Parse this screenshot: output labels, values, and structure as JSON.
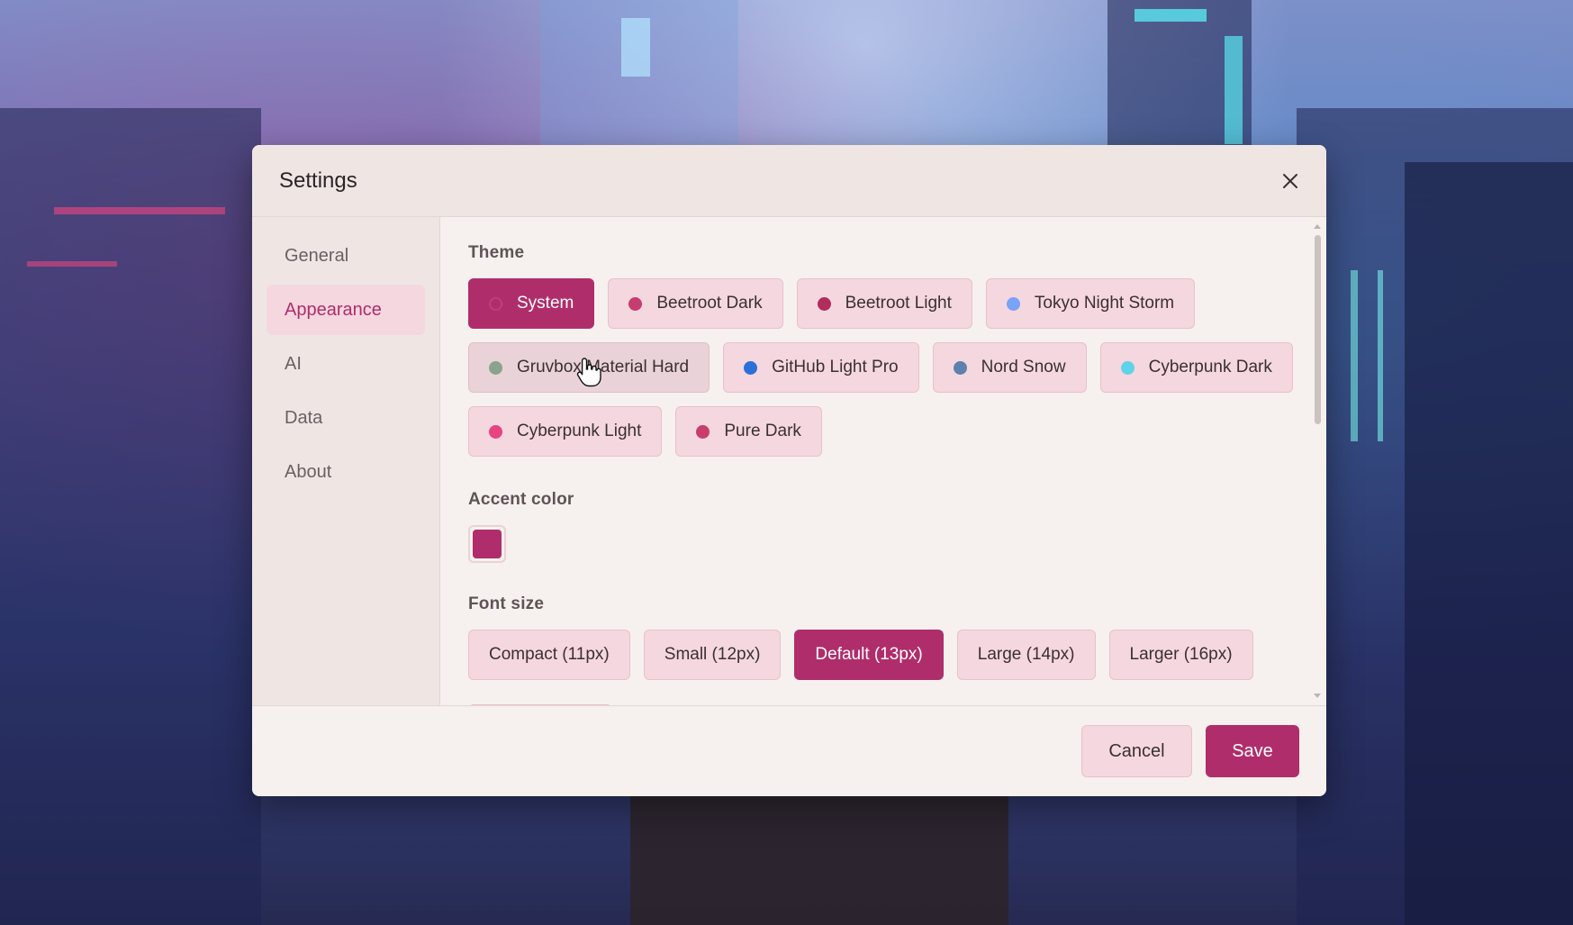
{
  "dialog": {
    "title": "Settings",
    "close_icon": "close-icon"
  },
  "sidebar": {
    "items": [
      {
        "label": "General",
        "active": false
      },
      {
        "label": "Appearance",
        "active": true
      },
      {
        "label": "AI",
        "active": false
      },
      {
        "label": "Data",
        "active": false
      },
      {
        "label": "About",
        "active": false
      }
    ]
  },
  "theme": {
    "label": "Theme",
    "options": [
      {
        "label": "System",
        "dot_color": "#c53d7e",
        "selected": true
      },
      {
        "label": "Beetroot Dark",
        "dot_color": "#c53d6e",
        "selected": false
      },
      {
        "label": "Beetroot Light",
        "dot_color": "#b02d5e",
        "selected": false
      },
      {
        "label": "Tokyo Night Storm",
        "dot_color": "#7aa2f7",
        "selected": false
      },
      {
        "label": "Gruvbox Material Hard",
        "dot_color": "#89a38f",
        "selected": false
      },
      {
        "label": "GitHub Light Pro",
        "dot_color": "#2d6fd8",
        "selected": false
      },
      {
        "label": "Nord Snow",
        "dot_color": "#5e81ac",
        "selected": false
      },
      {
        "label": "Cyberpunk Dark",
        "dot_color": "#5fd3e8",
        "selected": false
      },
      {
        "label": "Cyberpunk Light",
        "dot_color": "#e8447f",
        "selected": false
      },
      {
        "label": "Pure Dark",
        "dot_color": "#c83d6e",
        "selected": false
      }
    ]
  },
  "accent": {
    "label": "Accent color",
    "color": "#b02d6b"
  },
  "font_size": {
    "label": "Font size",
    "options": [
      {
        "label": "Compact (11px)",
        "selected": false
      },
      {
        "label": "Small (12px)",
        "selected": false
      },
      {
        "label": "Default (13px)",
        "selected": true
      },
      {
        "label": "Large (14px)",
        "selected": false
      },
      {
        "label": "Larger (16px)",
        "selected": false
      }
    ]
  },
  "footer": {
    "cancel_label": "Cancel",
    "save_label": "Save"
  },
  "colors": {
    "accent": "#b02d6b",
    "chip_bg": "#f5d7e0",
    "dialog_bg": "#f6f1ee"
  }
}
